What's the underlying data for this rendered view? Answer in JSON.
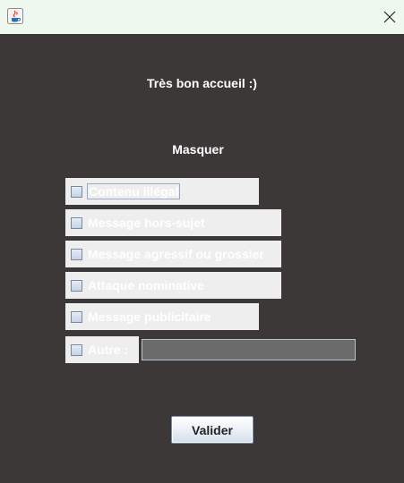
{
  "window": {
    "title": "",
    "icon": "java-cup-icon",
    "close_icon": "close-icon"
  },
  "welcome_text": "Très bon accueil :)",
  "section_title": "Masquer",
  "options": [
    {
      "label": "Contenu illégal",
      "checked": false
    },
    {
      "label": "Message hors-sujet",
      "checked": false
    },
    {
      "label": "Message agressif ou grossier",
      "checked": false
    },
    {
      "label": "Attaque nominative",
      "checked": false
    },
    {
      "label": "Message publicitaire",
      "checked": false
    },
    {
      "label": "Autre :",
      "checked": false
    }
  ],
  "other_input": {
    "value": "",
    "placeholder": ""
  },
  "submit_label": "Valider",
  "colors": {
    "background": "#3b3837",
    "titlebar": "#eef8ee",
    "option_bg": "#eeeeee",
    "input_bg": "#6b6b6b"
  }
}
